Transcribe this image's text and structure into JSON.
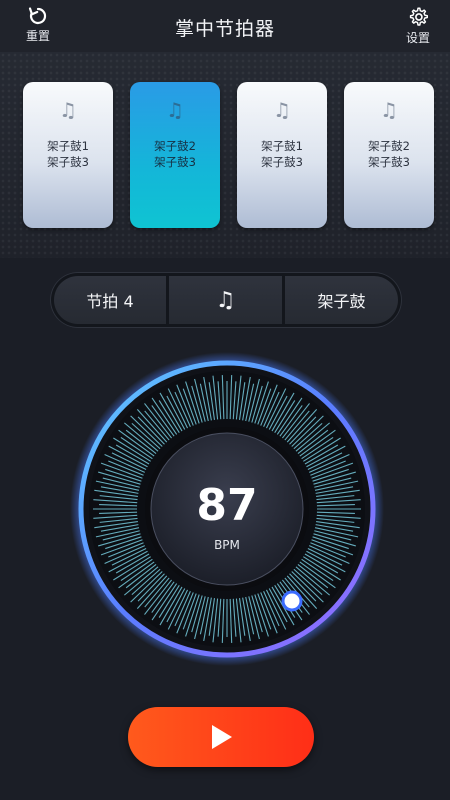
{
  "header": {
    "title": "掌中节拍器",
    "reset_label": "重置",
    "settings_label": "设置"
  },
  "cards": [
    {
      "line1": "架子鼓1",
      "line2": "架子鼓3",
      "active": false
    },
    {
      "line1": "架子鼓2",
      "line2": "架子鼓3",
      "active": true
    },
    {
      "line1": "架子鼓1",
      "line2": "架子鼓3",
      "active": false
    },
    {
      "line1": "架子鼓2",
      "line2": "架子鼓3",
      "active": false
    }
  ],
  "controls": {
    "beat_label": "节拍 4",
    "note_symbol": "♫",
    "sound_label": "架子鼓"
  },
  "tempo": {
    "bpm": "87",
    "unit": "BPM"
  },
  "colors": {
    "accent_cyan": "#14b6d8",
    "play_button": "#ff3a17",
    "dial_glow": "#5a8cff"
  },
  "icons": {
    "card_icon": "music-note-icon",
    "reset": "refresh-icon",
    "settings": "gear-icon",
    "play": "play-icon"
  }
}
